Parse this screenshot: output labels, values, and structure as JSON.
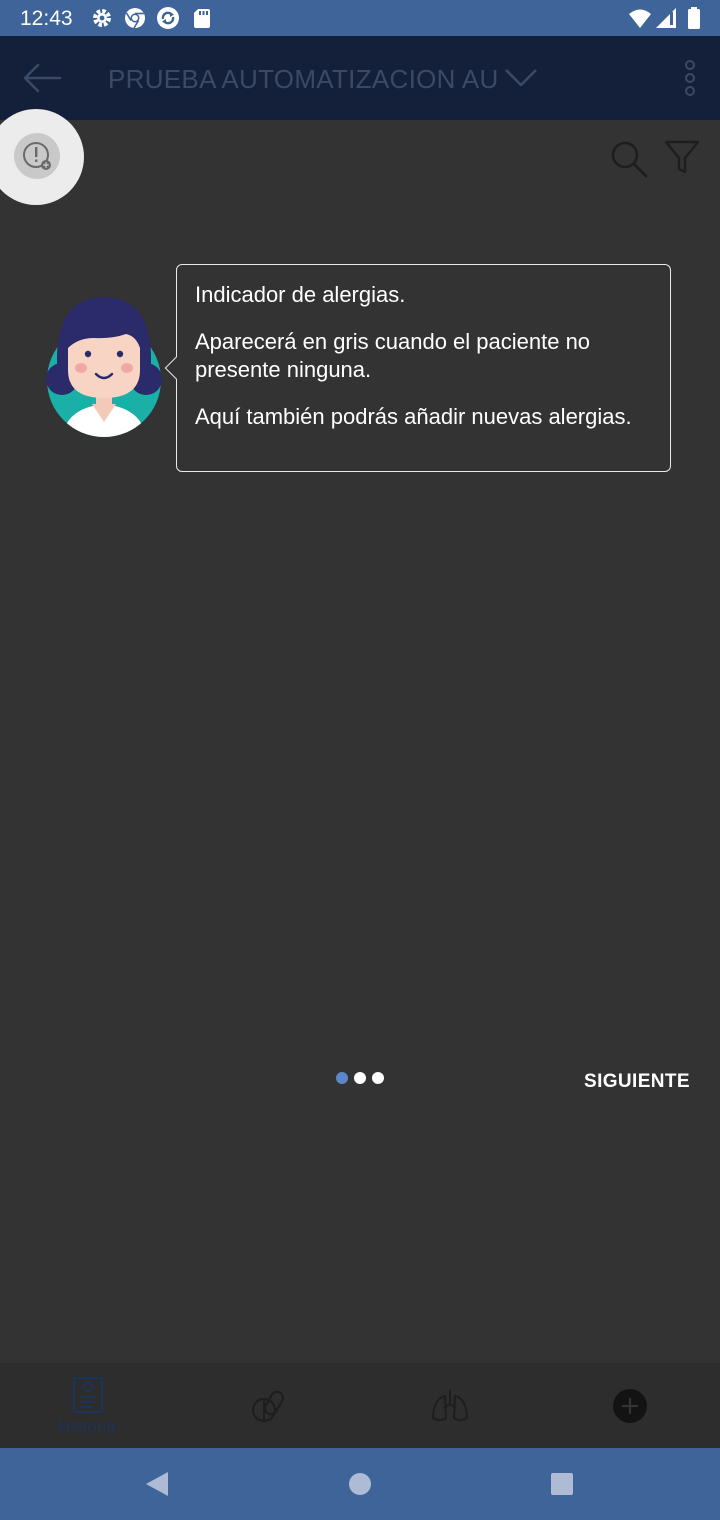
{
  "status_bar": {
    "time": "12:43",
    "icons": [
      "gear-icon",
      "chrome-icon",
      "sync-icon",
      "sd-card-icon",
      "wifi-icon",
      "signal-icon",
      "battery-icon"
    ]
  },
  "app_bar": {
    "title": "PRUEBA AUTOMATIZACION AU",
    "icons": [
      "back-arrow-icon",
      "chevron-down-icon",
      "overflow-menu-icon"
    ]
  },
  "toolbar": {
    "icons": [
      "allergy-indicator-icon",
      "search-icon",
      "filter-icon"
    ]
  },
  "tutorial": {
    "paragraphs": [
      "Indicador de alergias.",
      "Aparecerá en gris cuando el paciente no presente ninguna.",
      "Aquí también podrás añadir nuevas alergias."
    ],
    "pager_total": 3,
    "pager_current": 1,
    "next_label": "SIGUIENTE"
  },
  "bottom_tabs": [
    {
      "icon": "medical-history-icon",
      "label": "Historia"
    },
    {
      "icon": "pills-icon",
      "label": ""
    },
    {
      "icon": "lungs-icon",
      "label": ""
    },
    {
      "icon": "add-circle-icon",
      "label": ""
    }
  ],
  "nav_bar": {
    "icons": [
      "back-triangle-icon",
      "home-circle-icon",
      "recents-square-icon"
    ]
  },
  "colors": {
    "overlay_background": "#333333",
    "status_bar": "#3e6499",
    "active_dot": "#5b86c7",
    "inactive_dot": "#ffffff",
    "avatar_hair": "#2b2a6b",
    "avatar_background": "#1ab0a8"
  }
}
